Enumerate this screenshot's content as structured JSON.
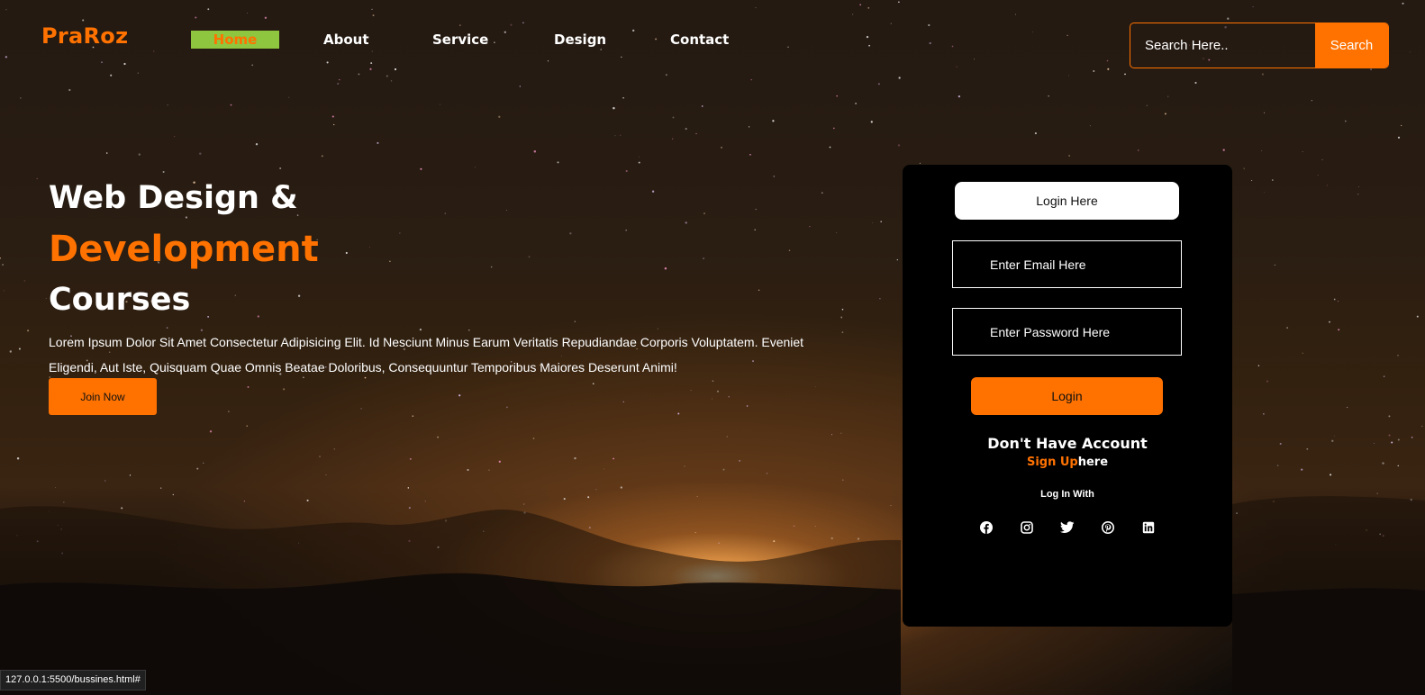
{
  "brand": {
    "logo": "PraRoz",
    "accent": "#ff7200",
    "active_nav_bg": "#8ec63f"
  },
  "nav": {
    "home": "Home",
    "about": "About",
    "service": "Service",
    "design": "Design",
    "contact": "Contact"
  },
  "search": {
    "placeholder": "Search Here..",
    "button": "Search"
  },
  "hero": {
    "line1": "Web Design &",
    "line2": "Development",
    "line3": "Courses",
    "paragraph": "Lorem Ipsum Dolor Sit Amet Consectetur Adipisicing Elit. Id Nesciunt Minus Earum Veritatis Repudiandae Corporis Voluptatem. Eveniet Eligendi, Aut Iste, Quisquam Quae Omnis Beatae Doloribus, Consequuntur Temporibus Maiores Deserunt Animi!",
    "cta": "Join Now"
  },
  "login": {
    "title": "Login Here",
    "email_placeholder": "Enter Email Here",
    "password_placeholder": "Enter Password Here",
    "button": "Login",
    "no_account": "Don't Have Account",
    "signup_link": "Sign Up",
    "signup_suffix": "here",
    "login_with": "Log In With",
    "socials": [
      "facebook-icon",
      "instagram-icon",
      "twitter-icon",
      "pinterest-icon",
      "linkedin-icon"
    ]
  },
  "statusbar": {
    "url": "127.0.0.1:5500/bussines.html#"
  }
}
